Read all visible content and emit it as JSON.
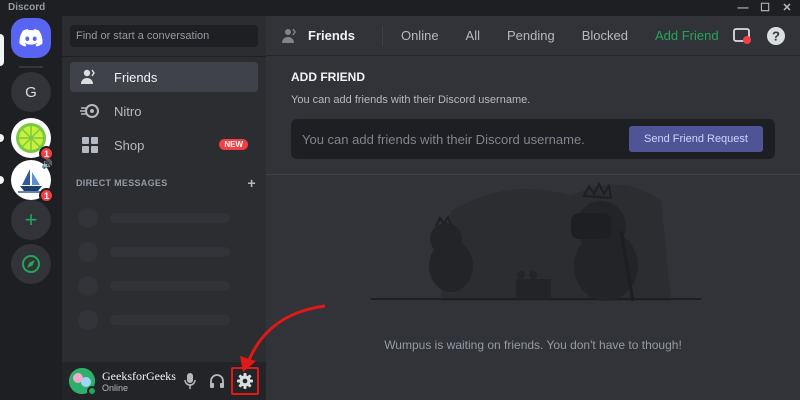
{
  "window": {
    "title": "Discord",
    "controls": [
      "—",
      "☐",
      "✕"
    ]
  },
  "servers": [
    {
      "label": "",
      "icon": "discord-logo-icon"
    },
    {
      "label": "G",
      "icon": ""
    },
    {
      "label": "",
      "icon": "lime-server-icon",
      "badge": "1"
    },
    {
      "label": "",
      "icon": "ship-server-icon",
      "badge": "1"
    },
    {
      "label": "+",
      "icon": "add-server-icon"
    },
    {
      "label": "",
      "icon": "explore-icon"
    }
  ],
  "sidebar": {
    "search_placeholder": "Find or start a conversation",
    "nav": [
      {
        "label": "Friends",
        "icon": "friends-icon"
      },
      {
        "label": "Nitro",
        "icon": "nitro-icon"
      },
      {
        "label": "Shop",
        "icon": "shop-icon",
        "badge": "NEW"
      }
    ],
    "dm_header": "DIRECT MESSAGES",
    "dm_add": "+"
  },
  "user": {
    "name": "GeeksforGeeks",
    "status": "Online"
  },
  "topbar": {
    "title": "Friends",
    "tabs": [
      "Online",
      "All",
      "Pending",
      "Blocked"
    ],
    "add_friend": "Add Friend"
  },
  "add_friend": {
    "title": "ADD FRIEND",
    "subtitle": "You can add friends with their Discord username.",
    "placeholder": "You can add friends with their Discord username.",
    "button": "Send Friend Request"
  },
  "empty_state": "Wumpus is waiting on friends. You don't have to though!",
  "colors": {
    "blurple": "#5865f2",
    "green": "#23a55a",
    "red": "#f23f43",
    "highlight": "#e01818"
  }
}
